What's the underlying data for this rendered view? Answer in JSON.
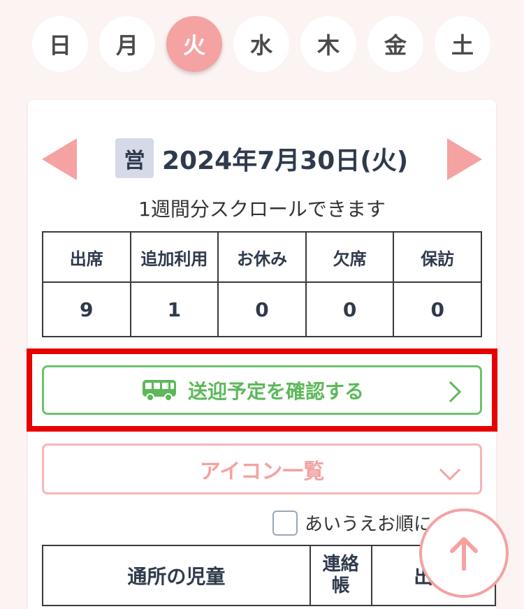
{
  "weekdays": {
    "items": [
      {
        "label": "日"
      },
      {
        "label": "月"
      },
      {
        "label": "火"
      },
      {
        "label": "水"
      },
      {
        "label": "木"
      },
      {
        "label": "金"
      },
      {
        "label": "土"
      }
    ],
    "selected": "火"
  },
  "date_header": {
    "badge": "営",
    "date": "2024年7月30日(火)",
    "scroll_note": "1週間分スクロールできます"
  },
  "stats": {
    "headers": [
      "出席",
      "追加利用",
      "お休み",
      "欠席",
      "保訪"
    ],
    "values": [
      "9",
      "1",
      "0",
      "0",
      "0"
    ]
  },
  "transport_button": {
    "label": "送迎予定を確認する",
    "icon": "bus-icon"
  },
  "icon_list_button": {
    "label": "アイコン一覧",
    "icon": "chevron-down-icon"
  },
  "sort": {
    "label": "あいうえお順に",
    "checked": false
  },
  "children_table": {
    "headers": [
      "通所の児童",
      "連絡帳",
      "出席"
    ]
  },
  "colors": {
    "accent_pink": "#f4a2a2",
    "accent_green": "#5cb85a",
    "highlight_red": "#e60000",
    "background": "#fcf3f3"
  }
}
